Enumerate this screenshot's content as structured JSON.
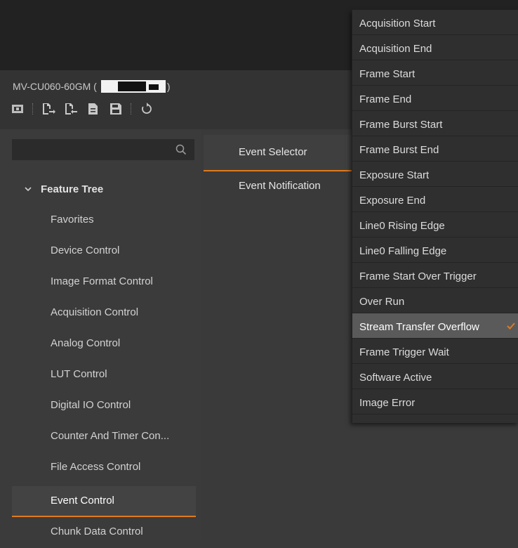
{
  "device": {
    "title": "MV-CU060-60GM (",
    "close_paren": ")"
  },
  "toolbar": {
    "icons": [
      "chip-icon",
      "import-icon",
      "export-icon",
      "document-icon",
      "save-icon",
      "refresh-icon"
    ]
  },
  "search": {
    "value": "",
    "placeholder": ""
  },
  "tree": {
    "root_label": "Feature Tree",
    "items": [
      {
        "label": "Favorites"
      },
      {
        "label": "Device Control"
      },
      {
        "label": "Image Format Control"
      },
      {
        "label": "Acquisition Control"
      },
      {
        "label": "Analog Control"
      },
      {
        "label": "LUT Control"
      },
      {
        "label": "Digital IO Control"
      },
      {
        "label": "Counter And Timer Con..."
      },
      {
        "label": "File Access Control"
      },
      {
        "label": "Event Control"
      },
      {
        "label": "Chunk Data Control"
      }
    ],
    "active_index": 9
  },
  "properties": [
    {
      "label": "Event Selector"
    },
    {
      "label": "Event Notification"
    }
  ],
  "dropdown": {
    "options": [
      {
        "label": "Acquisition Start"
      },
      {
        "label": "Acquisition End"
      },
      {
        "label": "Frame Start"
      },
      {
        "label": "Frame End"
      },
      {
        "label": "Frame Burst Start"
      },
      {
        "label": "Frame Burst End"
      },
      {
        "label": "Exposure Start"
      },
      {
        "label": "Exposure End"
      },
      {
        "label": "Line0 Rising Edge"
      },
      {
        "label": "Line0 Falling Edge"
      },
      {
        "label": "Frame Start Over Trigger"
      },
      {
        "label": "Over Run"
      },
      {
        "label": "Stream Transfer Overflow"
      },
      {
        "label": "Frame Trigger Wait"
      },
      {
        "label": "Software Active"
      },
      {
        "label": "Image Error"
      }
    ],
    "selected_index": 12
  },
  "colors": {
    "accent": "#e07a1f",
    "background": "#3a3a3a",
    "topbar": "#222222",
    "dropdown_bg": "#2f2f2f",
    "dropdown_selected": "#5a5a5a"
  }
}
